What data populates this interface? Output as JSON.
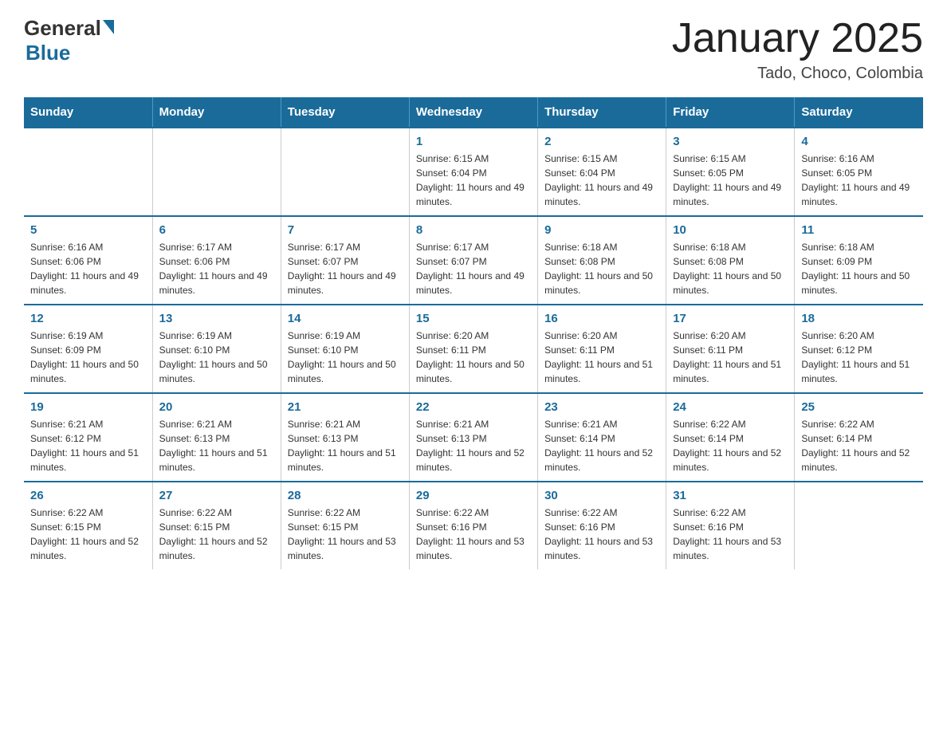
{
  "logo": {
    "general": "General",
    "blue": "Blue"
  },
  "title": "January 2025",
  "subtitle": "Tado, Choco, Colombia",
  "days_of_week": [
    "Sunday",
    "Monday",
    "Tuesday",
    "Wednesday",
    "Thursday",
    "Friday",
    "Saturday"
  ],
  "weeks": [
    {
      "days": [
        {
          "number": "",
          "info": ""
        },
        {
          "number": "",
          "info": ""
        },
        {
          "number": "",
          "info": ""
        },
        {
          "number": "1",
          "info": "Sunrise: 6:15 AM\nSunset: 6:04 PM\nDaylight: 11 hours and 49 minutes."
        },
        {
          "number": "2",
          "info": "Sunrise: 6:15 AM\nSunset: 6:04 PM\nDaylight: 11 hours and 49 minutes."
        },
        {
          "number": "3",
          "info": "Sunrise: 6:15 AM\nSunset: 6:05 PM\nDaylight: 11 hours and 49 minutes."
        },
        {
          "number": "4",
          "info": "Sunrise: 6:16 AM\nSunset: 6:05 PM\nDaylight: 11 hours and 49 minutes."
        }
      ]
    },
    {
      "days": [
        {
          "number": "5",
          "info": "Sunrise: 6:16 AM\nSunset: 6:06 PM\nDaylight: 11 hours and 49 minutes."
        },
        {
          "number": "6",
          "info": "Sunrise: 6:17 AM\nSunset: 6:06 PM\nDaylight: 11 hours and 49 minutes."
        },
        {
          "number": "7",
          "info": "Sunrise: 6:17 AM\nSunset: 6:07 PM\nDaylight: 11 hours and 49 minutes."
        },
        {
          "number": "8",
          "info": "Sunrise: 6:17 AM\nSunset: 6:07 PM\nDaylight: 11 hours and 49 minutes."
        },
        {
          "number": "9",
          "info": "Sunrise: 6:18 AM\nSunset: 6:08 PM\nDaylight: 11 hours and 50 minutes."
        },
        {
          "number": "10",
          "info": "Sunrise: 6:18 AM\nSunset: 6:08 PM\nDaylight: 11 hours and 50 minutes."
        },
        {
          "number": "11",
          "info": "Sunrise: 6:18 AM\nSunset: 6:09 PM\nDaylight: 11 hours and 50 minutes."
        }
      ]
    },
    {
      "days": [
        {
          "number": "12",
          "info": "Sunrise: 6:19 AM\nSunset: 6:09 PM\nDaylight: 11 hours and 50 minutes."
        },
        {
          "number": "13",
          "info": "Sunrise: 6:19 AM\nSunset: 6:10 PM\nDaylight: 11 hours and 50 minutes."
        },
        {
          "number": "14",
          "info": "Sunrise: 6:19 AM\nSunset: 6:10 PM\nDaylight: 11 hours and 50 minutes."
        },
        {
          "number": "15",
          "info": "Sunrise: 6:20 AM\nSunset: 6:11 PM\nDaylight: 11 hours and 50 minutes."
        },
        {
          "number": "16",
          "info": "Sunrise: 6:20 AM\nSunset: 6:11 PM\nDaylight: 11 hours and 51 minutes."
        },
        {
          "number": "17",
          "info": "Sunrise: 6:20 AM\nSunset: 6:11 PM\nDaylight: 11 hours and 51 minutes."
        },
        {
          "number": "18",
          "info": "Sunrise: 6:20 AM\nSunset: 6:12 PM\nDaylight: 11 hours and 51 minutes."
        }
      ]
    },
    {
      "days": [
        {
          "number": "19",
          "info": "Sunrise: 6:21 AM\nSunset: 6:12 PM\nDaylight: 11 hours and 51 minutes."
        },
        {
          "number": "20",
          "info": "Sunrise: 6:21 AM\nSunset: 6:13 PM\nDaylight: 11 hours and 51 minutes."
        },
        {
          "number": "21",
          "info": "Sunrise: 6:21 AM\nSunset: 6:13 PM\nDaylight: 11 hours and 51 minutes."
        },
        {
          "number": "22",
          "info": "Sunrise: 6:21 AM\nSunset: 6:13 PM\nDaylight: 11 hours and 52 minutes."
        },
        {
          "number": "23",
          "info": "Sunrise: 6:21 AM\nSunset: 6:14 PM\nDaylight: 11 hours and 52 minutes."
        },
        {
          "number": "24",
          "info": "Sunrise: 6:22 AM\nSunset: 6:14 PM\nDaylight: 11 hours and 52 minutes."
        },
        {
          "number": "25",
          "info": "Sunrise: 6:22 AM\nSunset: 6:14 PM\nDaylight: 11 hours and 52 minutes."
        }
      ]
    },
    {
      "days": [
        {
          "number": "26",
          "info": "Sunrise: 6:22 AM\nSunset: 6:15 PM\nDaylight: 11 hours and 52 minutes."
        },
        {
          "number": "27",
          "info": "Sunrise: 6:22 AM\nSunset: 6:15 PM\nDaylight: 11 hours and 52 minutes."
        },
        {
          "number": "28",
          "info": "Sunrise: 6:22 AM\nSunset: 6:15 PM\nDaylight: 11 hours and 53 minutes."
        },
        {
          "number": "29",
          "info": "Sunrise: 6:22 AM\nSunset: 6:16 PM\nDaylight: 11 hours and 53 minutes."
        },
        {
          "number": "30",
          "info": "Sunrise: 6:22 AM\nSunset: 6:16 PM\nDaylight: 11 hours and 53 minutes."
        },
        {
          "number": "31",
          "info": "Sunrise: 6:22 AM\nSunset: 6:16 PM\nDaylight: 11 hours and 53 minutes."
        },
        {
          "number": "",
          "info": ""
        }
      ]
    }
  ]
}
